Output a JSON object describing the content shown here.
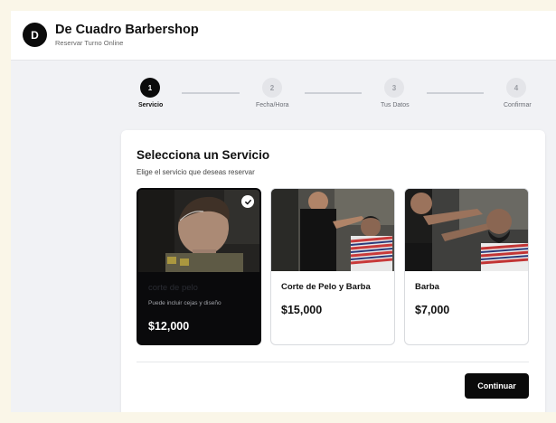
{
  "header": {
    "logo_letter": "D",
    "title": "De Cuadro Barbershop",
    "subtitle": "Reservar Turno Online"
  },
  "steps": [
    {
      "number": "1",
      "label": "Servicio",
      "active": true
    },
    {
      "number": "2",
      "label": "Fecha/Hora",
      "active": false
    },
    {
      "number": "3",
      "label": "Tus Datos",
      "active": false
    },
    {
      "number": "4",
      "label": "Confirmar",
      "active": false
    }
  ],
  "main": {
    "title": "Selecciona un Servicio",
    "subtitle": "Elige el servicio que deseas reservar",
    "services": [
      {
        "name": "corte de pelo",
        "description": "Puede incluir cejas y diseño",
        "price": "$12,000",
        "selected": true
      },
      {
        "name": "Corte de Pelo y Barba",
        "price": "$15,000",
        "selected": false
      },
      {
        "name": "Barba",
        "price": "$7,000",
        "selected": false
      }
    ],
    "continue_label": "Continuar"
  },
  "colors": {
    "accent": "#0b0b0b",
    "page_background": "#f1f2f5",
    "card_background": "#ffffff",
    "inactive_step": "#e4e5e9"
  },
  "icons": {
    "selected_marker": "check-icon"
  }
}
